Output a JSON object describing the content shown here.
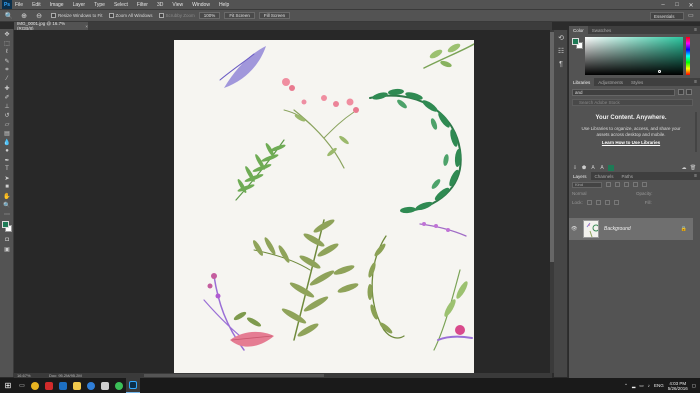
{
  "app": {
    "logo": "Ps"
  },
  "menu": [
    "File",
    "Edit",
    "Image",
    "Layer",
    "Type",
    "Select",
    "Filter",
    "3D",
    "View",
    "Window",
    "Help"
  ],
  "window_controls": {
    "minimize": "–",
    "maximize": "□",
    "close": "✕"
  },
  "options_bar": {
    "resize_windows": "Resize Windows to Fit",
    "zoom_all": "Zoom All Windows",
    "scrubby_zoom": "Scrubby Zoom",
    "btn_100": "100%",
    "btn_fit": "Fit Screen",
    "btn_fill": "Fill Screen",
    "workspace": "Essentials"
  },
  "document": {
    "tab_title": "IMG_0001.jpg @ 16.7% (RGB/8)",
    "tab_close": "×",
    "zoom": "16.67%",
    "doc_size": "Doc: 95.2M/95.2M"
  },
  "panels": {
    "color_tabs": [
      "Color",
      "Swatches"
    ],
    "library_tabs": [
      "Libraries",
      "Adjustments",
      "Styles"
    ],
    "library_select": "and",
    "library_search_placeholder": "Search Adobe Stock",
    "library_title": "Your Content. Anywhere.",
    "library_body": "Use Libraries to organize, access, and share your assets across desktop and mobile.",
    "library_link": "Learn How to Use Libraries",
    "layers_tabs": [
      "Layers",
      "Channels",
      "Paths"
    ],
    "layers_kind": "Kind",
    "layers_blend": "Normal",
    "layers_opacity": "Opacity:",
    "layers_lock": "Lock:",
    "layers_fill": "Fill:",
    "layer_name": "Background"
  },
  "taskbar": {
    "apps": [
      "chrome",
      "acrobat",
      "outlook",
      "file-explorer",
      "edge",
      "store",
      "whatsapp",
      "photoshop"
    ],
    "language": "ENG",
    "time": "4:03 PM",
    "date": "5/26/2016"
  },
  "colors": {
    "foreground": "#1e7a56",
    "accent": "#31a8ff"
  }
}
